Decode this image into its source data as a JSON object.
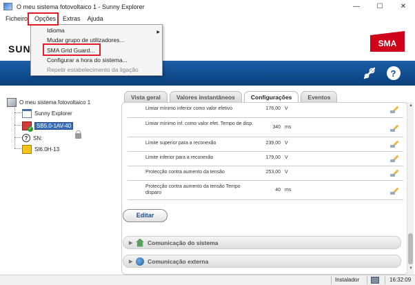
{
  "window": {
    "title": "O meu sistema fotovoltaico 1 - Sunny Explorer",
    "minimize": "—",
    "maximize": "☐",
    "close": "✕"
  },
  "menubar": [
    "Ficheiro",
    "Opções",
    "Extras",
    "Ajuda"
  ],
  "options_menu": {
    "items": [
      {
        "label": "Idioma",
        "submenu": true,
        "enabled": true
      },
      {
        "label": "Mudar grupo de utilizadores...",
        "submenu": false,
        "enabled": true
      },
      {
        "label": "SMA Grid Guard...",
        "submenu": false,
        "enabled": true
      },
      {
        "label": "Configurar a hora do sistema...",
        "submenu": false,
        "enabled": true
      },
      {
        "label": "Repetir estabelecimento da ligação",
        "submenu": false,
        "enabled": false
      }
    ],
    "submenu_arrow": "▶"
  },
  "header": {
    "brand": "SUNN",
    "logo": "SMA",
    "logo_color": "#d0021b"
  },
  "toolbar": {
    "help": "?",
    "wrench": "wrench-icon"
  },
  "tree": {
    "root": "O meu sistema fotovoltaico 1",
    "nodes": [
      {
        "label": "Sunny Explorer",
        "icon": "explorer-icon"
      },
      {
        "label": "SB5.0-1AV-40",
        "icon": "inverter-icon",
        "selected": true
      },
      {
        "label": "SN:",
        "icon": "unknown-device-icon"
      },
      {
        "label": "SI6.0H-13",
        "icon": "warning-device-icon"
      }
    ],
    "unknown_icon_glyph": "?"
  },
  "tabs": [
    {
      "label": "Vista geral",
      "active": false
    },
    {
      "label": "Valores instantâneos",
      "active": false
    },
    {
      "label": "Configurações",
      "active": true
    },
    {
      "label": "Eventos",
      "active": false
    }
  ],
  "parameters": [
    {
      "name": "Limiar mínimo inferior como valor efetivo",
      "value": "176,00",
      "unit": "V"
    },
    {
      "name": "Limiar mínimo inf. como valor efet. Tempo de disp.",
      "value": "340",
      "unit": "ms"
    },
    {
      "name": "Limite superior para a reconexão",
      "value": "239,00",
      "unit": "V"
    },
    {
      "name": "Limite inferior para a reconexão",
      "value": "179,00",
      "unit": "V"
    },
    {
      "name": "Protecção contra aumento da tensão",
      "value": "253,00",
      "unit": "V"
    },
    {
      "name": "Protecção contra aumento da tensão Tempo disparo",
      "value": "40",
      "unit": "ms"
    }
  ],
  "edit_button": "Editar",
  "sections": [
    {
      "label": "Comunicação do sistema",
      "icon": "home-icon",
      "arrow": "▶"
    },
    {
      "label": "Comunicação externa",
      "icon": "globe-icon",
      "arrow": "▶"
    }
  ],
  "statusbar": {
    "user": "Instalador",
    "time": "16:32:09"
  },
  "colors": {
    "accent_blue": "#0f4b8d",
    "highlight_red": "#e01b24"
  }
}
